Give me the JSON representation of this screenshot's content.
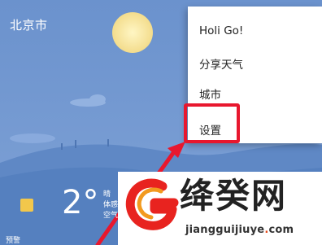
{
  "weather": {
    "city": "北京市",
    "temperature": "2°",
    "condition_lines": [
      "晴",
      "体感",
      "空气"
    ],
    "warning_label": "预警"
  },
  "menu": {
    "items": [
      {
        "label": "Holi Go!"
      },
      {
        "label": "分享天气"
      },
      {
        "label": "城市"
      },
      {
        "label": "设置"
      }
    ]
  },
  "watermark": {
    "title": "绛癸网",
    "url_prefix": "jiangguijiuye",
    "url_dot": ".",
    "url_suffix": "com"
  },
  "colors": {
    "sky": "#6f96cf",
    "sun": "#f6e7a8",
    "highlight": "#e8172e",
    "logo_red": "#e8231f",
    "logo_orange": "#f29a1f"
  }
}
